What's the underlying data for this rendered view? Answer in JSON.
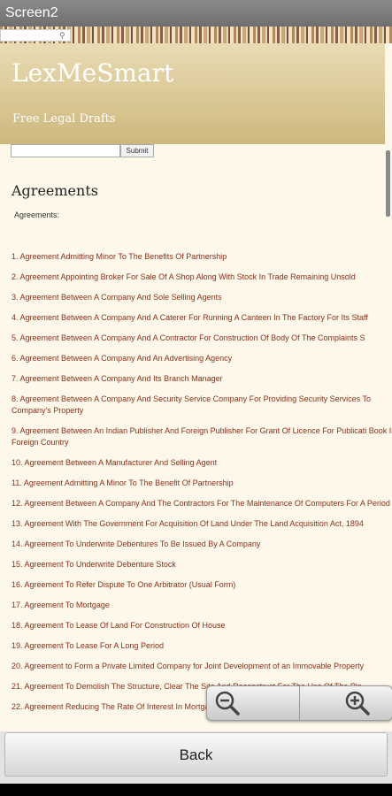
{
  "window": {
    "title": "Screen2"
  },
  "site": {
    "title": "LexMeSmart",
    "subtitle": "Free Legal Drafts"
  },
  "search": {
    "submit_label": "Submit"
  },
  "section": {
    "title": "Agreements",
    "subtitle": "Agreements:"
  },
  "items": [
    "1. Agreement Admitting Minor To The Benefits Of Partnership",
    "2. Agreement Appointing Broker For Sale Of A Shop Along With Stock In Trade Remaining Unsold",
    "3. Agreement Between A Company And Sole Selling Agents",
    "4. Agreement Between A Company And A Caterer For Running A Canteen In The Factory For Its Staff",
    "5. Agreement Between A Company And A Contractor For Construction Of Body Of The Complaints S",
    "6. Agreement Between A Company And An Advertising Agency",
    "7. Agreement Between A Company And Its Branch Manager",
    "8. Agreement Between A Company And Security Service Company For Providing Security Services To Company's Property",
    "9. Agreement Between An Indian Publisher And Foreign Publisher For Grant Of Licence For Publicati Book In Foreign Country",
    "10. Agreement Between A Manufacturer And Selling Agent",
    "11. Agreement Admitting A Minor To The Benefit Of Partnership",
    "12. Agreement Between A Company And The Contractors For The Maintenance Of Computers For A Period",
    "13. Agreement With The Government For Acquisition Of Land  Under The Land Acquisition Act, 1894",
    "14. Agreement To Underwrite Debentures To Be Issued By A Company",
    "15. Agreement To Underwrite Debenture Stock",
    "16. Agreement To Refer Dispute To One Arbitrator (Usual Form)",
    "17. Agreement To Mortgage",
    "18. Agreement To Lease Of Land For Construction Of House",
    "19. Agreement To Lease For A Long Period",
    "20. Agreement to Form a Private Limited Company for Joint Development of an Immovable Property",
    "21. Agreement To Demolish The Structure, Clear The Site And Reconstruct For The Use Of The Plo",
    "22. Agreement Reducing The Rate Of Interest In Mortgage Deed"
  ],
  "buttons": {
    "back": "Back"
  },
  "icons": {
    "zoom_out": "zoom-out-icon",
    "zoom_in": "zoom-in-icon",
    "search": "search-icon"
  },
  "colors": {
    "link": "#8b2f1a",
    "header": "#cdb77d",
    "background": "#fdf8ea"
  }
}
